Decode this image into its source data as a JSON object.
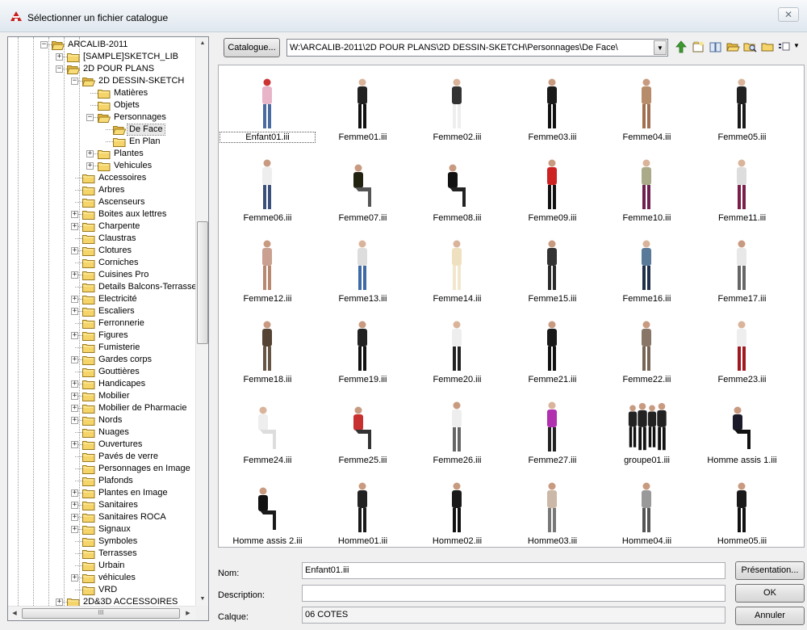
{
  "window": {
    "title": "Sélectionner un fichier catalogue",
    "close_glyph": "✕",
    "icon": "app-logo-icon"
  },
  "tree": {
    "items": [
      {
        "label": "ARCALIB-2011",
        "depth": 0,
        "expander": "−",
        "open": true
      },
      {
        "label": "[SAMPLE]SKETCH_LIB",
        "depth": 1,
        "expander": "+"
      },
      {
        "label": "2D POUR PLANS",
        "depth": 1,
        "expander": "−",
        "open": true
      },
      {
        "label": "2D DESSIN-SKETCH",
        "depth": 2,
        "expander": "−",
        "open": true
      },
      {
        "label": "Matières",
        "depth": 3
      },
      {
        "label": "Objets",
        "depth": 3
      },
      {
        "label": "Personnages",
        "depth": 3,
        "expander": "−",
        "open": true
      },
      {
        "label": "De Face",
        "depth": 4,
        "selected": true,
        "open": true
      },
      {
        "label": "En Plan",
        "depth": 4
      },
      {
        "label": "Plantes",
        "depth": 3,
        "expander": "+"
      },
      {
        "label": "Vehicules",
        "depth": 3,
        "expander": "+"
      },
      {
        "label": "Accessoires",
        "depth": 2
      },
      {
        "label": "Arbres",
        "depth": 2
      },
      {
        "label": "Ascenseurs",
        "depth": 2
      },
      {
        "label": "Boites aux lettres",
        "depth": 2,
        "expander": "+"
      },
      {
        "label": "Charpente",
        "depth": 2,
        "expander": "+"
      },
      {
        "label": "Claustras",
        "depth": 2
      },
      {
        "label": "Clotures",
        "depth": 2,
        "expander": "+"
      },
      {
        "label": "Corniches",
        "depth": 2
      },
      {
        "label": "Cuisines Pro",
        "depth": 2,
        "expander": "+"
      },
      {
        "label": "Details Balcons-Terrasse",
        "depth": 2
      },
      {
        "label": "Electricité",
        "depth": 2,
        "expander": "+"
      },
      {
        "label": "Escaliers",
        "depth": 2,
        "expander": "+"
      },
      {
        "label": "Ferronnerie",
        "depth": 2
      },
      {
        "label": "Figures",
        "depth": 2,
        "expander": "+"
      },
      {
        "label": "Fumisterie",
        "depth": 2
      },
      {
        "label": "Gardes corps",
        "depth": 2,
        "expander": "+"
      },
      {
        "label": "Gouttières",
        "depth": 2
      },
      {
        "label": "Handicapes",
        "depth": 2,
        "expander": "+"
      },
      {
        "label": "Mobilier",
        "depth": 2,
        "expander": "+"
      },
      {
        "label": "Mobilier de Pharmacie",
        "depth": 2,
        "expander": "+"
      },
      {
        "label": "Nords",
        "depth": 2,
        "expander": "+"
      },
      {
        "label": "Nuages",
        "depth": 2
      },
      {
        "label": "Ouvertures",
        "depth": 2,
        "expander": "+"
      },
      {
        "label": "Pavés de verre",
        "depth": 2
      },
      {
        "label": "Personnages en Image",
        "depth": 2
      },
      {
        "label": "Plafonds",
        "depth": 2
      },
      {
        "label": "Plantes en Image",
        "depth": 2,
        "expander": "+"
      },
      {
        "label": "Sanitaires",
        "depth": 2,
        "expander": "+"
      },
      {
        "label": "Sanitaires ROCA",
        "depth": 2,
        "expander": "+"
      },
      {
        "label": "Signaux",
        "depth": 2,
        "expander": "+"
      },
      {
        "label": "Symboles",
        "depth": 2
      },
      {
        "label": "Terrasses",
        "depth": 2
      },
      {
        "label": "Urbain",
        "depth": 2
      },
      {
        "label": "véhicules",
        "depth": 2,
        "expander": "+"
      },
      {
        "label": "VRD",
        "depth": 2
      },
      {
        "label": "2D&3D ACCESSOIRES",
        "depth": 1,
        "expander": "+"
      }
    ],
    "scroll_hint": "III"
  },
  "toolbar": {
    "catalogue_label": "Catalogue...",
    "path": "W:\\ARCALIB-2011\\2D POUR PLANS\\2D DESSIN-SKETCH\\Personnages\\De Face\\",
    "dropdown_glyph": "▼",
    "view_glyph": "▼",
    "icons": [
      "up-folder-icon",
      "new-folder-icon",
      "book-icon",
      "open-folder-icon",
      "search-folder-icon",
      "folder-icon",
      "view-options-icon"
    ]
  },
  "grid": {
    "items": [
      {
        "name": "Enfant01.iii",
        "selected": true,
        "c": [
          "#e8b4c8",
          "#4a6aa0",
          "#c33"
        ]
      },
      {
        "name": "Femme01.iii",
        "c": [
          "#222",
          "#111",
          "#d9b49a"
        ]
      },
      {
        "name": "Femme02.iii",
        "c": [
          "#333",
          "#eee",
          "#d9b49a"
        ]
      },
      {
        "name": "Femme03.iii",
        "c": [
          "#1a1a1a",
          "#111",
          "#c89a80"
        ]
      },
      {
        "name": "Femme04.iii",
        "c": [
          "#b78c6a",
          "#a07050",
          "#c89a80"
        ]
      },
      {
        "name": "Femme05.iii",
        "c": [
          "#222",
          "#1a1a1a",
          "#d9b49a"
        ]
      },
      {
        "name": "Femme06.iii",
        "c": [
          "#eee",
          "#3a4f7a",
          "#c89a80"
        ]
      },
      {
        "name": "Femme07.iii",
        "c": [
          "#221",
          "#555",
          "#c89a80"
        ],
        "seated": true
      },
      {
        "name": "Femme08.iii",
        "c": [
          "#111",
          "#222",
          "#c89a80"
        ],
        "seated": true
      },
      {
        "name": "Femme09.iii",
        "c": [
          "#c22",
          "#111",
          "#c89a80"
        ]
      },
      {
        "name": "Femme10.iii",
        "c": [
          "#aa8",
          "#702050",
          "#d9b49a"
        ]
      },
      {
        "name": "Femme11.iii",
        "c": [
          "#ddd",
          "#7a1f4a",
          "#d9b49a"
        ]
      },
      {
        "name": "Femme12.iii",
        "c": [
          "#caa090",
          "#b88870",
          "#c89a80"
        ]
      },
      {
        "name": "Femme13.iii",
        "c": [
          "#ddd",
          "#3f6aa5",
          "#d9b49a"
        ]
      },
      {
        "name": "Femme14.iii",
        "c": [
          "#efe0c0",
          "#f2e6cc",
          "#d9b49a"
        ]
      },
      {
        "name": "Femme15.iii",
        "c": [
          "#333",
          "#2a2a2a",
          "#c89a80"
        ]
      },
      {
        "name": "Femme16.iii",
        "c": [
          "#5a7a9a",
          "#20304a",
          "#d9b49a"
        ]
      },
      {
        "name": "Femme17.iii",
        "c": [
          "#e8e8e8",
          "#666",
          "#c89a80"
        ]
      },
      {
        "name": "Femme18.iii",
        "c": [
          "#554433",
          "#665544",
          "#c89a80"
        ]
      },
      {
        "name": "Femme19.iii",
        "c": [
          "#222",
          "#111",
          "#c89a80"
        ]
      },
      {
        "name": "Femme20.iii",
        "c": [
          "#eee",
          "#222",
          "#d9b49a"
        ]
      },
      {
        "name": "Femme21.iii",
        "c": [
          "#1a1a1a",
          "#111",
          "#c89a80"
        ]
      },
      {
        "name": "Femme22.iii",
        "c": [
          "#887766",
          "#776655",
          "#c89a80"
        ]
      },
      {
        "name": "Femme23.iii",
        "c": [
          "#eee",
          "#a01820",
          "#d9b49a"
        ]
      },
      {
        "name": "Femme24.iii",
        "c": [
          "#eee",
          "#ddd",
          "#d9b49a"
        ],
        "seated": true
      },
      {
        "name": "Femme25.iii",
        "c": [
          "#c83030",
          "#333",
          "#c89a80"
        ],
        "seated": true
      },
      {
        "name": "Femme26.iii",
        "c": [
          "#eee",
          "#666",
          "#c89a80"
        ]
      },
      {
        "name": "Femme27.iii",
        "c": [
          "#b030b0",
          "#222",
          "#d9b49a"
        ]
      },
      {
        "name": "groupe01.iii",
        "c": [
          "#222",
          "#111",
          "#c89a80"
        ],
        "group": true
      },
      {
        "name": "Homme assis 1.iii",
        "c": [
          "#1a1a2a",
          "#111",
          "#c89a80"
        ],
        "seated": true
      },
      {
        "name": "Homme assis 2.iii",
        "c": [
          "#111",
          "#1a1a1a",
          "#c89a80"
        ],
        "seated": true
      },
      {
        "name": "Homme01.iii",
        "c": [
          "#222",
          "#1a1a1a",
          "#c89a80"
        ]
      },
      {
        "name": "Homme02.iii",
        "c": [
          "#1a1a1a",
          "#111",
          "#c89a80"
        ]
      },
      {
        "name": "Homme03.iii",
        "c": [
          "#ccb8a8",
          "#777",
          "#c89a80"
        ]
      },
      {
        "name": "Homme04.iii",
        "c": [
          "#999",
          "#555",
          "#c89a80"
        ]
      },
      {
        "name": "Homme05.iii",
        "c": [
          "#1a1a1a",
          "#111",
          "#c89a80"
        ]
      }
    ]
  },
  "form": {
    "nom_label": "Nom:",
    "nom_value": "Enfant01.iii",
    "description_label": "Description:",
    "description_value": "",
    "calque_label": "Calque:",
    "calque_value": "06 COTES",
    "presentation_label": "Présentation...",
    "ok_label": "OK",
    "cancel_label": "Annuler"
  },
  "colors": {
    "folder_yellow": "#f5d46a",
    "accent_red": "#c81e1e",
    "green": "#3c9a2e"
  }
}
